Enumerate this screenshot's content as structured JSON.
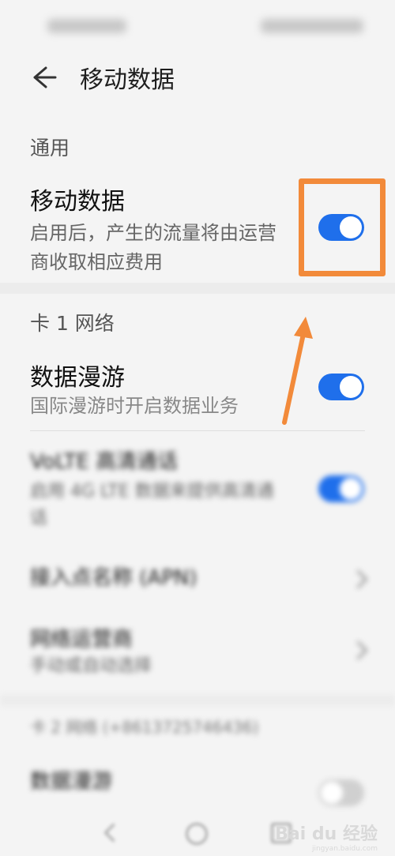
{
  "header": {
    "title": "移动数据"
  },
  "general": {
    "section_label": "通用",
    "mobile_data": {
      "title": "移动数据",
      "description": "启用后，产生的流量将由运营商收取相应费用",
      "enabled": true
    }
  },
  "sim1": {
    "section_label": "卡 1 网络",
    "data_roaming": {
      "title": "数据漫游",
      "description": "国际漫游时开启数据业务",
      "enabled": true
    },
    "volte": {
      "title": "VoLTE 高清通话",
      "description": "启用 4G LTE 数据来提供高清通话",
      "enabled": true
    },
    "apn": {
      "title": "接入点名称 (APN)"
    },
    "carrier": {
      "title": "网络运营商",
      "description": "手动或自动选择"
    }
  },
  "sim2": {
    "section_label": "卡 2 网络 (+8613725746436)",
    "data_roaming": {
      "title": "数据漫游",
      "enabled": false
    }
  },
  "colors": {
    "accent": "#1f6feb",
    "highlight": "#f28a3a"
  },
  "watermark": {
    "brand": "Bai du 经验",
    "url": "jingyan.baidu.com"
  }
}
